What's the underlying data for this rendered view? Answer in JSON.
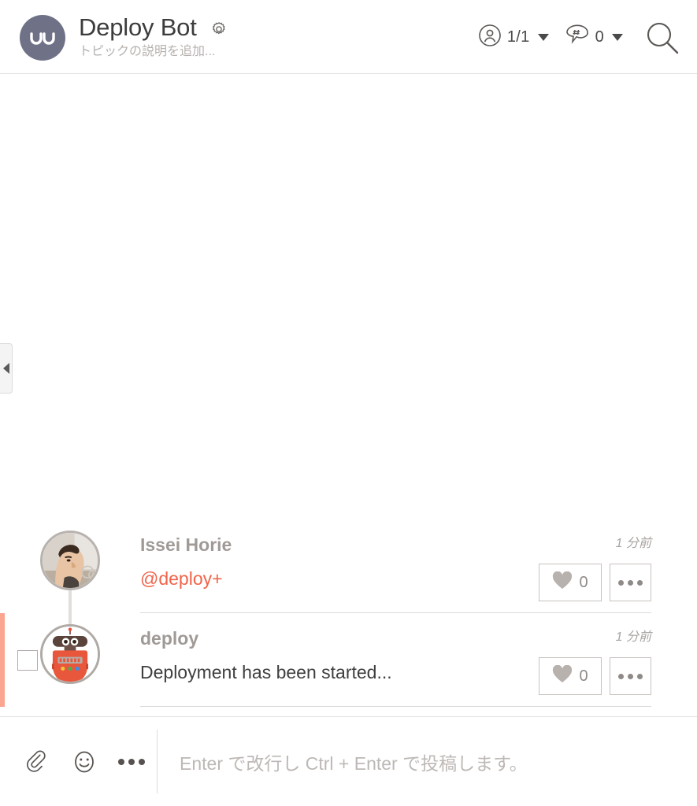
{
  "header": {
    "logo_text": "nu",
    "logo_color": "#6f7287",
    "topic_title": "Deploy Bot",
    "topic_description": "トピックの説明を追加...",
    "settings_icon": "gear-icon",
    "members_icon": "person-circle-icon",
    "members_count": "1/1",
    "tags_icon": "hashtag-bubble-icon",
    "tags_count": "0",
    "search_icon": "search-icon"
  },
  "sidebar": {
    "collapse_icon": "chevron-left-icon"
  },
  "messages": [
    {
      "avatar_type": "photo",
      "author": "Issei Horie",
      "timestamp": "1 分前",
      "text": "@deploy+",
      "is_mention": true,
      "like_count": "0",
      "like_icon": "heart-icon",
      "more_icon": "ellipsis-icon",
      "unread": false,
      "selectable": false
    },
    {
      "avatar_type": "robot",
      "author": "deploy",
      "timestamp": "1 分前",
      "text": "Deployment has been started...",
      "is_mention": false,
      "like_count": "0",
      "like_icon": "heart-icon",
      "more_icon": "ellipsis-icon",
      "unread": true,
      "selectable": true
    }
  ],
  "composer": {
    "attach_icon": "paperclip-icon",
    "emoji_icon": "smiley-icon",
    "more_icon": "ellipsis-icon",
    "placeholder": "Enter で改行し Ctrl + Enter で投稿します。"
  },
  "colors": {
    "mention": "#f1634a",
    "unread_bar": "#f9a58f",
    "brand": "#6f7287"
  }
}
